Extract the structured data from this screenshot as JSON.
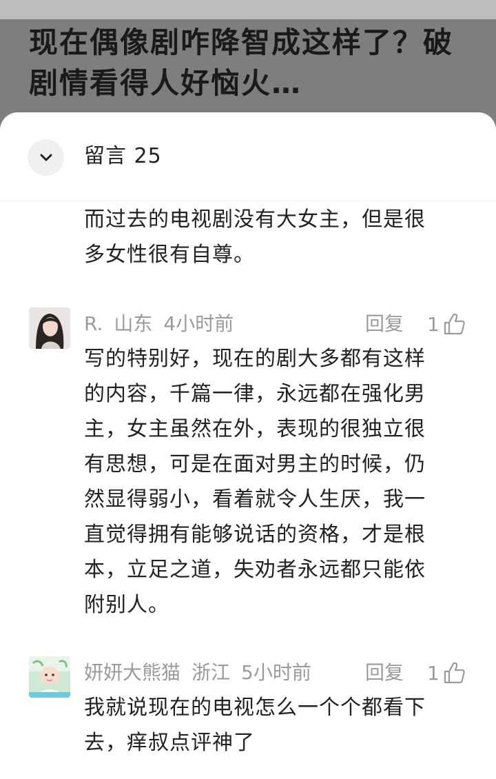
{
  "article": {
    "title": "现在偶像剧咋降智成这样了？破剧情看得人好恼火…"
  },
  "panel": {
    "title": "留言 25"
  },
  "comments": [
    {
      "text_lines": [
        "而过去的电视剧没有大女主，但是很",
        "多女性很有自尊。"
      ]
    },
    {
      "user": "R.",
      "location": "山东",
      "time": "4小时前",
      "reply_label": "回复",
      "likes": "1",
      "text_lines": [
        "写的特别好，现在的剧大多都有这样",
        "的内容，千篇一律，永远都在强化男",
        "主，女主虽然在外，表现的很独立很",
        "有思想，可是在面对男主的时候，仍",
        "然显得弱小，看着就令人生厌，我一",
        "直觉得拥有能够说话的资格，才是根",
        "本，立足之道，失劝者永远都只能依",
        "附别人。"
      ]
    },
    {
      "user": "妍妍大熊猫",
      "location": "浙江",
      "time": "5小时前",
      "reply_label": "回复",
      "likes": "1",
      "text_lines": [
        "我就说现在的电视怎么一个个都看下",
        "去，痒叔点评神了"
      ]
    }
  ],
  "colors": {
    "overlay": "#7e7e7e",
    "meta_text": "#9a9a9a",
    "body_text": "#222222"
  },
  "icons": [
    "chevron-down-icon",
    "thumbs-up-icon"
  ]
}
